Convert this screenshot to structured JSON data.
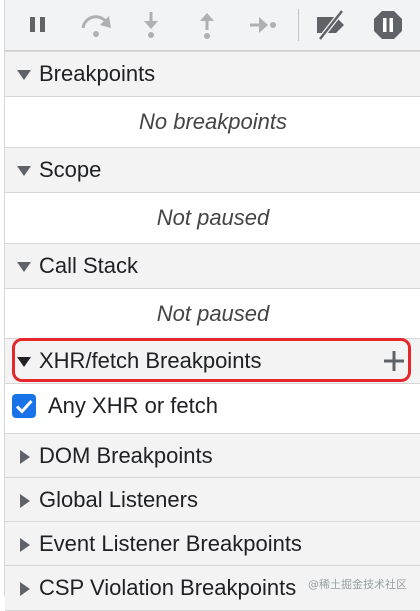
{
  "toolbar": {
    "buttons": [
      {
        "icon": "pause-icon"
      },
      {
        "icon": "step-over-icon"
      },
      {
        "icon": "step-into-icon"
      },
      {
        "icon": "step-out-icon"
      },
      {
        "icon": "step-icon"
      },
      {
        "icon": "deactivate-breakpoints-icon"
      },
      {
        "icon": "pause-on-exceptions-icon"
      }
    ]
  },
  "sections": {
    "breakpoints": {
      "title": "Breakpoints",
      "expanded": true,
      "empty": "No breakpoints"
    },
    "scope": {
      "title": "Scope",
      "expanded": true,
      "empty": "Not paused"
    },
    "call_stack": {
      "title": "Call Stack",
      "expanded": true,
      "empty": "Not paused"
    },
    "xhr": {
      "title": "XHR/fetch Breakpoints",
      "expanded": true,
      "add_icon": "plus-icon",
      "items": [
        {
          "label": "Any XHR or fetch",
          "checked": true
        }
      ]
    },
    "dom": {
      "title": "DOM Breakpoints",
      "expanded": false
    },
    "global": {
      "title": "Global Listeners",
      "expanded": false
    },
    "event": {
      "title": "Event Listener Breakpoints",
      "expanded": false
    },
    "csp": {
      "title": "CSP Violation Breakpoints",
      "expanded": false
    }
  },
  "watermark": "@稀土掘金技术社区",
  "colors": {
    "accent": "#1a73e8",
    "highlight": "#e5262a",
    "icon": "#5f6368",
    "icon_disabled": "#b0b0b0"
  }
}
